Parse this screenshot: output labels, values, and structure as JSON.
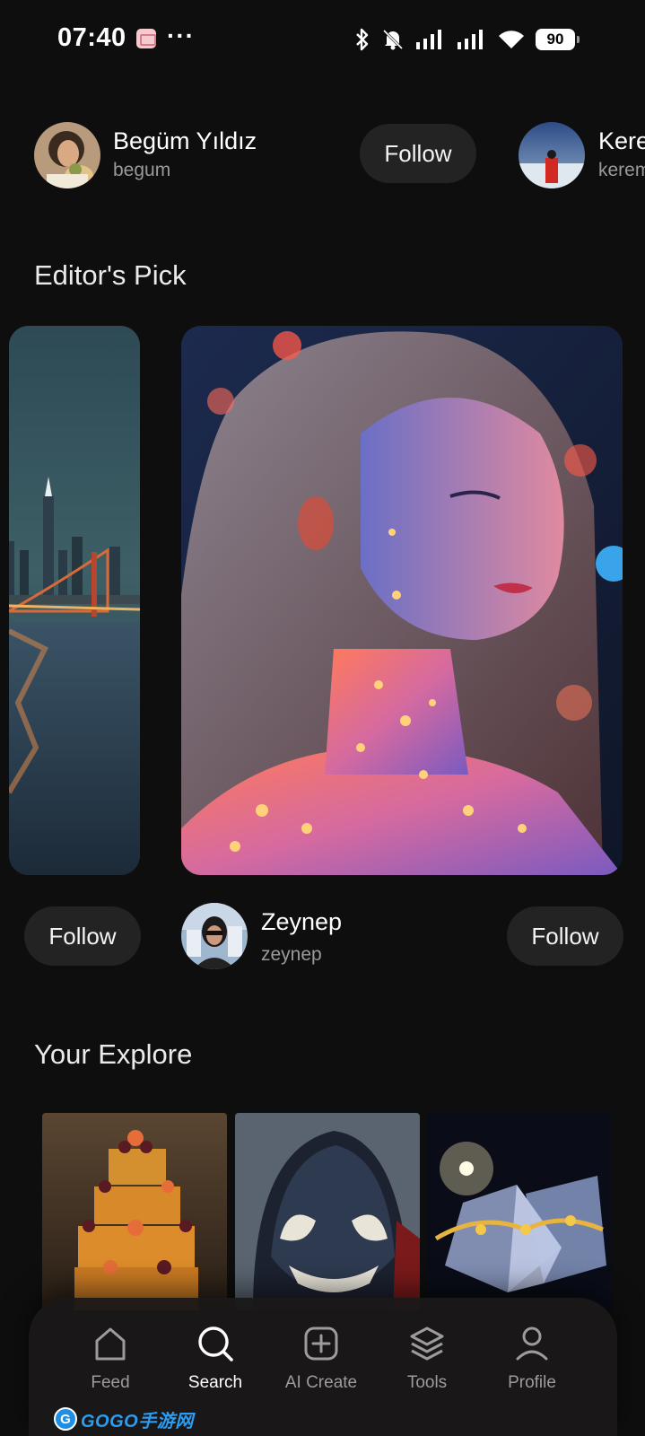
{
  "status_bar": {
    "time": "07:40",
    "more": "···",
    "battery": "90"
  },
  "suggested_users": [
    {
      "name": "Begüm Yıldız",
      "handle": "begum",
      "follow_label": "Follow"
    },
    {
      "name": "Kerem",
      "handle": "kerem"
    }
  ],
  "editors_pick": {
    "title": "Editor's Pick",
    "cards": [
      {
        "follow_label": "Follow"
      },
      {
        "name": "Zeynep",
        "handle": "zeynep",
        "follow_label": "Follow"
      }
    ]
  },
  "your_explore": {
    "title": "Your Explore"
  },
  "bottom_nav": {
    "items": [
      {
        "label": "Feed",
        "icon": "home-icon"
      },
      {
        "label": "Search",
        "icon": "search-icon",
        "active": true
      },
      {
        "label": "AI Create",
        "icon": "plus-square-icon"
      },
      {
        "label": "Tools",
        "icon": "layers-icon"
      },
      {
        "label": "Profile",
        "icon": "user-icon"
      }
    ]
  },
  "watermark": {
    "text": "GOGO手游网"
  }
}
